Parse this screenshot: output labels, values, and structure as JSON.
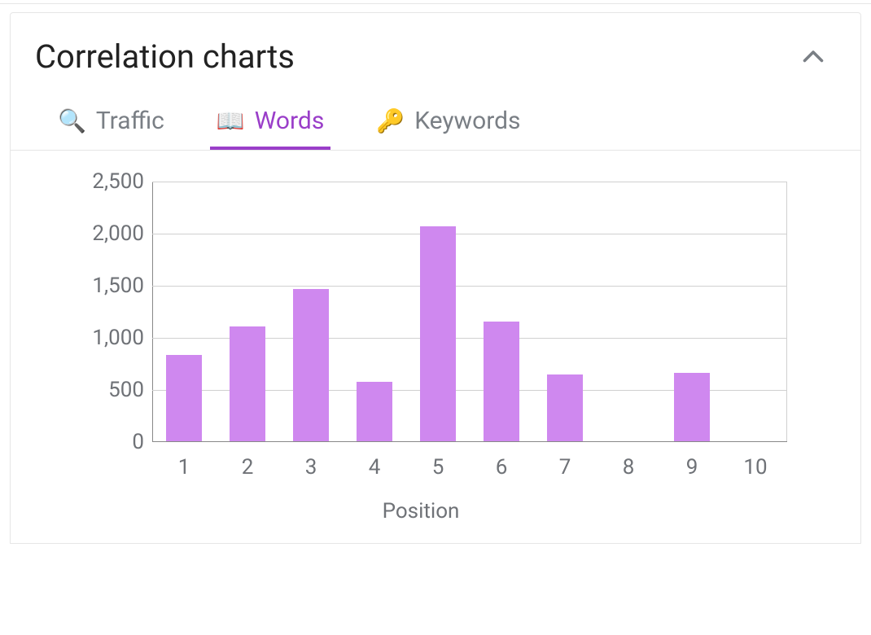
{
  "header": {
    "title": "Correlation charts"
  },
  "tabs": [
    {
      "label": "Traffic",
      "emoji": "🔍",
      "active": false
    },
    {
      "label": "Words",
      "emoji": "📖",
      "active": true
    },
    {
      "label": "Keywords",
      "emoji": "🔑",
      "active": false
    }
  ],
  "chart_data": {
    "type": "bar",
    "categories": [
      "1",
      "2",
      "3",
      "4",
      "5",
      "6",
      "7",
      "8",
      "9",
      "10"
    ],
    "values": [
      830,
      1100,
      1460,
      570,
      2060,
      1150,
      640,
      0,
      660,
      0
    ],
    "title": "",
    "xlabel": "Position",
    "ylabel": "",
    "ylim": [
      0,
      2500
    ],
    "yticks": [
      0,
      500,
      1000,
      1500,
      2000,
      2500
    ],
    "yticklabels": [
      "0",
      "500",
      "1,000",
      "1,500",
      "2,000",
      "2,500"
    ],
    "bar_color": "#cf88ef"
  }
}
